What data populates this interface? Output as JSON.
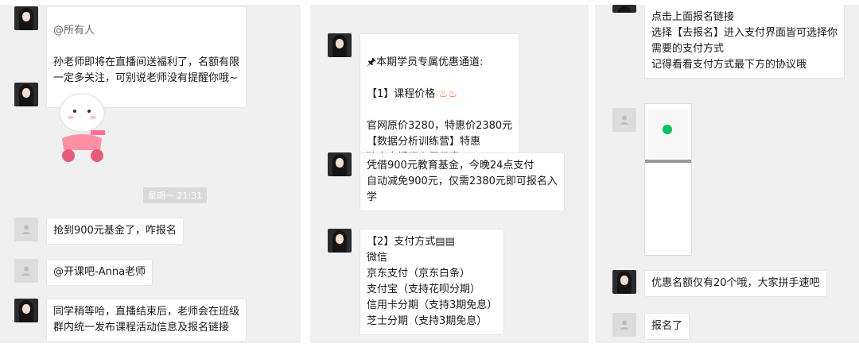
{
  "panel1": {
    "top_fragment": "@所有人",
    "msg1": "孙老师即将在直播间送福利了，名额有限\n一定多关注，可别说老师没有提醒你哦~",
    "time": "星期一 21:31",
    "msg2": "抢到900元基金了，咋报名",
    "msg3": "@开课吧-Anna老师",
    "msg4": "同学稍等哈，直播结束后，老师会在班级\n群内统一发布课程活动信息及报名链接"
  },
  "panel2": {
    "msg1_title": "🖈本期学员专属优惠通道:",
    "msg1_l2": "【1】课程价格",
    "msg1_body": "官网原价3280，特惠价2380元\n【数据分析训练营】特惠\n独享直播间专属优惠!",
    "msg2": "凭借900元教育基金，今晚24点支付\n自动减免900元，仅需2380元即可报名入\n学",
    "msg3": "【2】支付方式▤▤\n微信\n京东支付（京东白条）\n支付宝（支持花呗分期）\n信用卡分期（支持3期免息）\n芝士分期（支持3期免息）"
  },
  "panel3": {
    "msg1": "点击上面报名链接\n选择【去报名】进入支付界面皆可选择你\n需要的支付方式\n记得看看支付方式最下方的协议哦",
    "msg2": "优惠名额仅有20个哦，大家拼手速吧",
    "msg3": "报名了"
  },
  "colors": {
    "panel_bg": "#f0f0f0",
    "bubble_bg": "#ffffff",
    "accent": "#07c160"
  }
}
